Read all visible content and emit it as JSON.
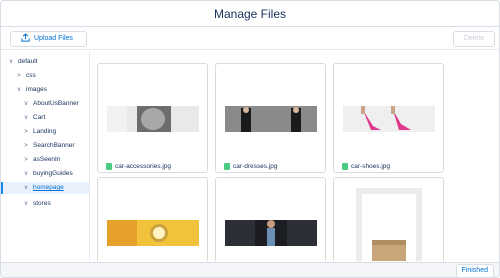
{
  "header": {
    "title": "Manage Files"
  },
  "toolbar": {
    "upload_label": "Upload Files",
    "delete_label": "Delete"
  },
  "tree": [
    {
      "label": "default",
      "chevron": "v"
    },
    {
      "label": "css",
      "chevron": ">"
    },
    {
      "label": "images",
      "chevron": "v"
    },
    {
      "label": "AboutUsBanner",
      "chevron": "v"
    },
    {
      "label": "Cart",
      "chevron": "v"
    },
    {
      "label": "Landing",
      "chevron": ">"
    },
    {
      "label": "SearchBanner",
      "chevron": ">"
    },
    {
      "label": "asSeenIn",
      "chevron": ">"
    },
    {
      "label": "buyingGuides",
      "chevron": "v"
    },
    {
      "label": "homepage",
      "chevron": "v",
      "selected": true
    },
    {
      "label": "stores",
      "chevron": "v"
    }
  ],
  "files": [
    {
      "name": "car-accessories.jpg",
      "icon": "image-file-icon"
    },
    {
      "name": "car-dresses.jpg",
      "icon": "image-file-icon"
    },
    {
      "name": "car-shoes.jpg",
      "icon": "image-file-icon"
    },
    {
      "name": "",
      "icon": ""
    },
    {
      "name": "",
      "icon": ""
    },
    {
      "name": "",
      "icon": ""
    }
  ],
  "footer": {
    "finished_label": "Finished"
  },
  "colors": {
    "accent": "#0070d2",
    "file_icon": "#4bca81",
    "selection": "#e8f0fb"
  }
}
